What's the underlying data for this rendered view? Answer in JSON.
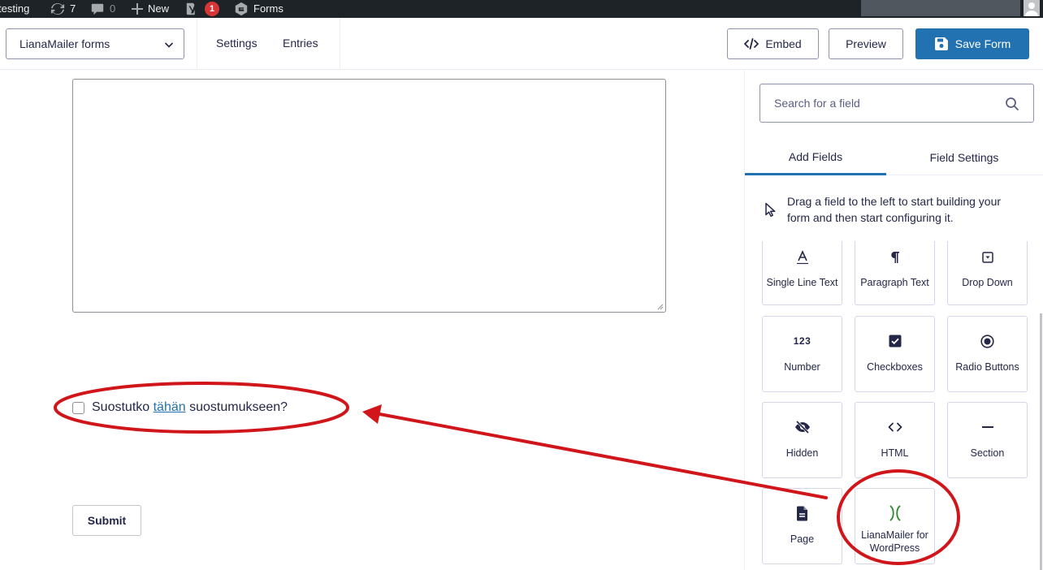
{
  "admin_bar": {
    "site_name": "testing",
    "updates_count": "7",
    "comments_count": "0",
    "new_label": "New",
    "yoast_badge": "1",
    "forms_label": "Forms"
  },
  "toolbar": {
    "form_selector": "LianaMailer forms",
    "links": {
      "settings": "Settings",
      "entries": "Entries"
    },
    "embed_label": "Embed",
    "preview_label": "Preview",
    "save_label": "Save Form"
  },
  "canvas": {
    "consent": {
      "before": "Suostutko ",
      "link": "tähän",
      "after": " suostumukseen?"
    },
    "submit_label": "Submit"
  },
  "sidebar": {
    "search_placeholder": "Search for a field",
    "tabs": {
      "add_fields": "Add Fields",
      "field_settings": "Field Settings"
    },
    "hint": "Drag a field to the left to start building your form and then start configuring it.",
    "fields": [
      {
        "label": "Single Line Text",
        "icon": "single-line-text-icon"
      },
      {
        "label": "Paragraph Text",
        "icon": "paragraph-icon"
      },
      {
        "label": "Drop Down",
        "icon": "dropdown-icon"
      },
      {
        "label": "Number",
        "icon": "number-icon"
      },
      {
        "label": "Checkboxes",
        "icon": "checkbox-icon"
      },
      {
        "label": "Radio Buttons",
        "icon": "radio-icon"
      },
      {
        "label": "Hidden",
        "icon": "eye-slash-icon"
      },
      {
        "label": "HTML",
        "icon": "code-icon"
      },
      {
        "label": "Section",
        "icon": "minus-icon"
      },
      {
        "label": "Page",
        "icon": "document-icon"
      },
      {
        "label": "LianaMailer for WordPress",
        "label_line1": "LianaMailer for",
        "label_line2": "WordPress",
        "icon": "lianamailer-logo-icon"
      }
    ],
    "number_icon_text": "123"
  },
  "annotation": {
    "color": "#d0161a"
  }
}
